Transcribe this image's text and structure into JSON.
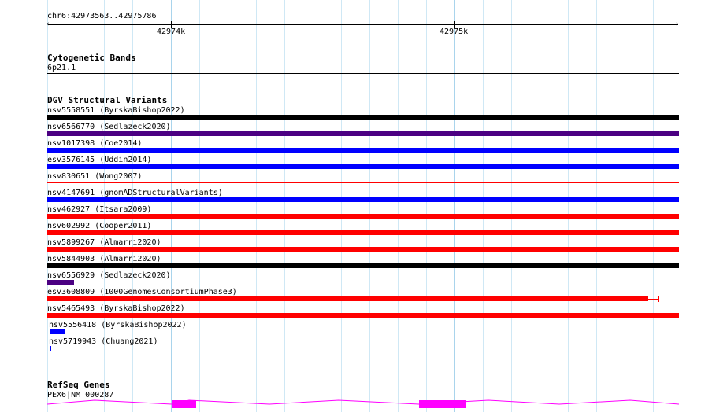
{
  "ruler": {
    "location": "chr6:42973563..42975786",
    "major_ticks": [
      "42974k",
      "42975k"
    ]
  },
  "cytogenetic": {
    "title": "Cytogenetic Bands",
    "band": "6p21.1"
  },
  "dgv": {
    "title": "DGV Structural Variants",
    "variants": [
      {
        "label": "nsv5558551 (ByrskaBishop2022)",
        "color": "#000000"
      },
      {
        "label": "nsv6566770 (Sedlazeck2020)",
        "color": "#4b0082"
      },
      {
        "label": "nsv1017398 (Coe2014)",
        "color": "#0000ff"
      },
      {
        "label": "esv3576145 (Uddin2014)",
        "color": "#0000ff"
      },
      {
        "label": "nsv830651 (Wong2007)",
        "color": "#ff0000"
      },
      {
        "label": "nsv4147691 (gnomADStructuralVariants)",
        "color": "#0000ff"
      },
      {
        "label": "nsv462927 (Itsara2009)",
        "color": "#ff0000"
      },
      {
        "label": "nsv602992 (Cooper2011)",
        "color": "#ff0000"
      },
      {
        "label": "nsv5899267 (Almarri2020)",
        "color": "#ff0000"
      },
      {
        "label": "nsv5844903 (Almarri2020)",
        "color": "#000000"
      },
      {
        "label": "nsv6556929 (Sedlazeck2020)",
        "color": "#4b0082"
      },
      {
        "label": "esv3608809 (1000GenomesConsortiumPhase3)",
        "color": "#ff0000"
      },
      {
        "label": "nsv5465493 (ByrskaBishop2022)",
        "color": "#ff0000"
      },
      {
        "label": "nsv5556418 (ByrskaBishop2022)",
        "color": "#0000ff"
      },
      {
        "label": "nsv5719943 (Chuang2021)",
        "color": "#0000ff"
      }
    ]
  },
  "refseq": {
    "title": "RefSeq Genes",
    "gene": "PEX6|NM_000287",
    "color": "#ff00ff"
  }
}
